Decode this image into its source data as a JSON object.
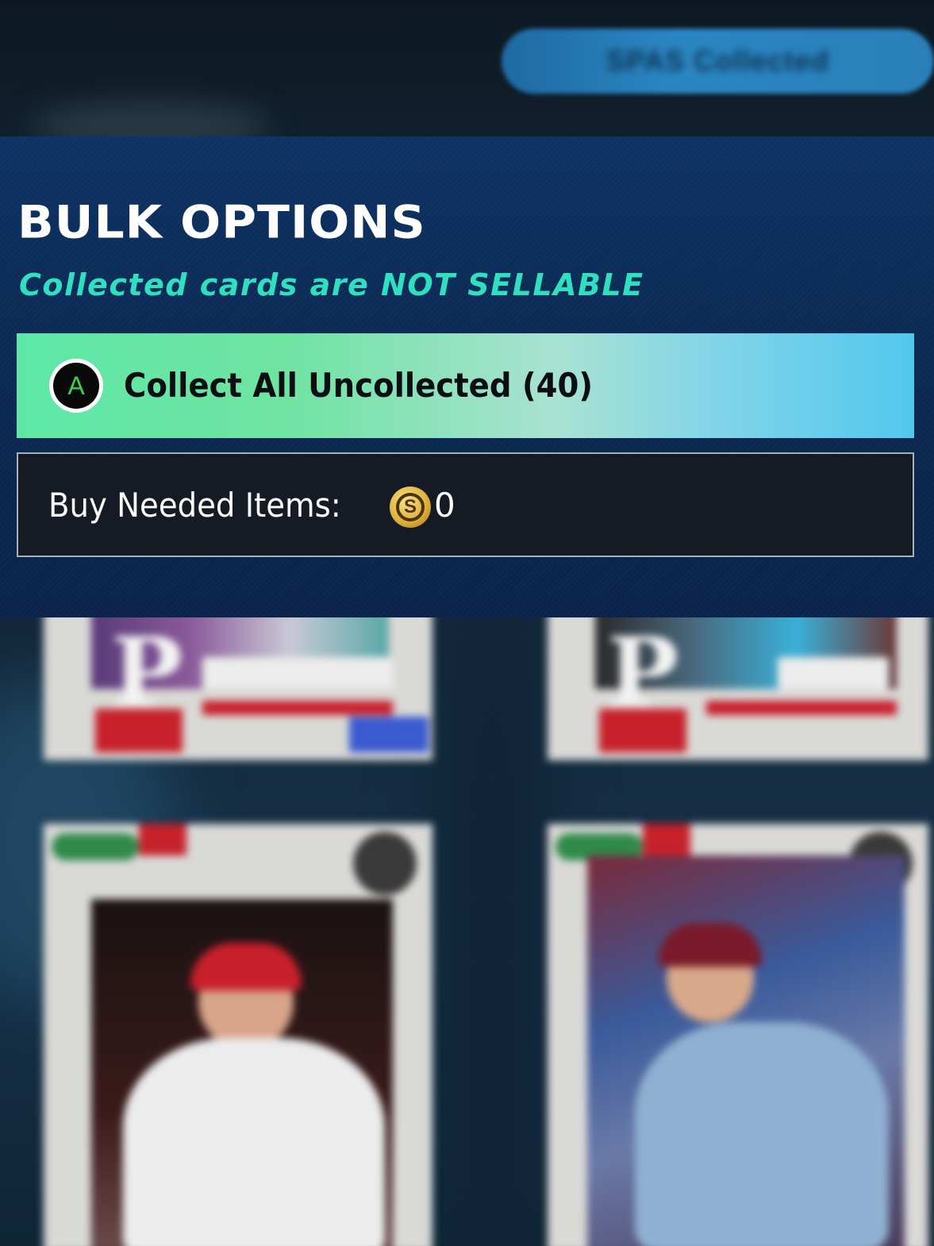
{
  "top_bar": {
    "pill_label": "SPAS Collected"
  },
  "bulk_options": {
    "title": "BULK OPTIONS",
    "subtitle": "Collected cards are NOT SELLABLE",
    "collect_option": {
      "button_glyph": "A",
      "label": "Collect All Uncollected (40)"
    },
    "buy_option": {
      "label": "Buy Needed Items:",
      "currency_icon": "stubs-coin-icon",
      "currency_glyph": "S",
      "value": "0"
    }
  },
  "colors": {
    "panel_background": "#0b2a55",
    "subtitle_accent": "#2fe0c0",
    "collect_gradient_start": "#5ee8a6",
    "collect_gradient_end": "#52c8ec",
    "buy_background": "#151b24",
    "card_red": "#c7212b"
  },
  "cards": [
    {
      "team_logo": "P"
    },
    {
      "team_logo": "P"
    },
    {
      "team_logo": ""
    },
    {
      "team_logo": ""
    }
  ]
}
